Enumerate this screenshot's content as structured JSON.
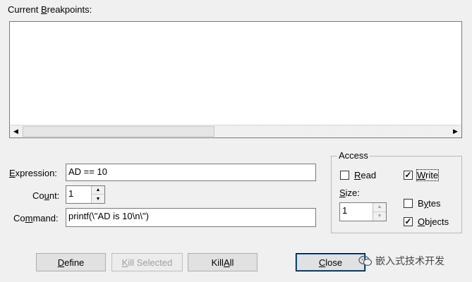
{
  "breakpoints": {
    "label_pre": "Current ",
    "label_key": "B",
    "label_post": "reakpoints:",
    "items": []
  },
  "expression": {
    "label_pre": "",
    "label_key": "E",
    "label_post": "xpression:",
    "value": "AD == 10"
  },
  "count": {
    "label_pre": "Co",
    "label_key": "u",
    "label_post": "nt:",
    "value": "1"
  },
  "command": {
    "label_pre": "Co",
    "label_key": "m",
    "label_post": "mand:",
    "value": "printf(\\\"AD is 10\\n\\\")"
  },
  "access": {
    "title": "Access",
    "read": {
      "label_pre": "",
      "label_key": "R",
      "label_post": "ead",
      "checked": false
    },
    "write": {
      "label_pre": "",
      "label_key": "W",
      "label_post": "rite",
      "checked": true
    },
    "size_label_pre": "",
    "size_label_key": "S",
    "size_label_post": "ize:",
    "size_value": "1",
    "bytes": {
      "label_pre": "B",
      "label_key": "y",
      "label_post": "tes",
      "checked": false
    },
    "objects": {
      "label_pre": "",
      "label_key": "O",
      "label_post": "bjects",
      "checked": true
    }
  },
  "buttons": {
    "define": {
      "pre": "",
      "key": "D",
      "post": "efine"
    },
    "kill_selected": {
      "pre": "",
      "key": "K",
      "post": "ill Selected"
    },
    "kill_all": {
      "pre": "Kill ",
      "key": "A",
      "post": "ll"
    },
    "close": {
      "pre": "",
      "key": "C",
      "post": "lose"
    }
  },
  "watermark": "嵌入式技术开发"
}
